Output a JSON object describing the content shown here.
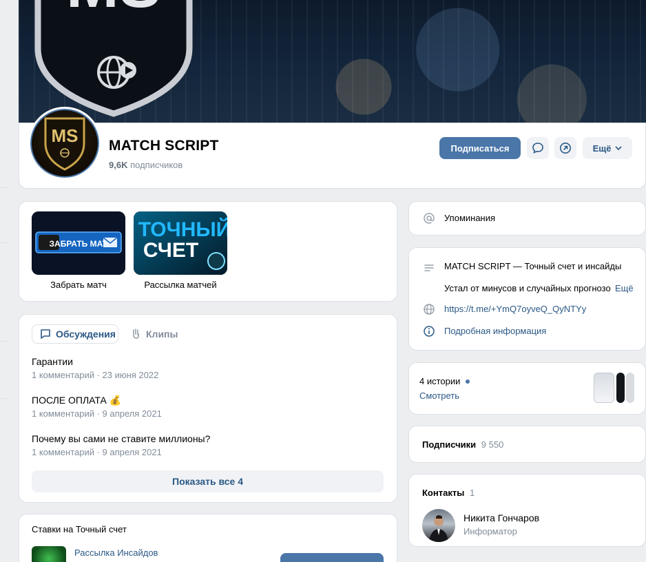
{
  "header": {
    "group_name": "MATCH SCRIPT",
    "subscribers_count": "9,6K",
    "subscribers_label": "подписчиков",
    "subscribe_button": "Подписаться",
    "more_button": "Ещё",
    "cover_logo_text": "MS"
  },
  "apps": [
    {
      "label": "Забрать матч",
      "tile_text": "ЗАБРАТЬ МАТЧ"
    },
    {
      "label": "Рассылка матчей",
      "tile_text_1": "ТОЧНЫЙ",
      "tile_text_2": "СЧЕТ"
    }
  ],
  "tabs": {
    "discussions": "Обсуждения",
    "clips": "Клипы"
  },
  "discussions": [
    {
      "title": "Гарантии",
      "comments": "1 комментарий",
      "date": "23 июня 2022"
    },
    {
      "title": "ПОСЛЕ ОПЛАТА 💰",
      "comments": "1 комментарий",
      "date": "9 апреля 2021"
    },
    {
      "title": "Почему вы сами не ставите миллионы?",
      "comments": "1 комментарий",
      "date": "9 апреля 2021"
    }
  ],
  "show_all": "Показать все 4",
  "bets_card": {
    "title": "Ставки на Точный счет",
    "item_label": "Рассылка Инсайдов"
  },
  "mentions": "Упоминания",
  "info": {
    "description_title": "MATCH SCRIPT — Точный счет и инсайды",
    "description_text": "Устал от минусов и случайных прогнозо",
    "more_link": "Ещё",
    "url": "https://t.me/+YmQ7oyveQ_QyNTYy",
    "details": "Подробная информация"
  },
  "stories": {
    "count_label": "4 истории",
    "view_link": "Смотреть"
  },
  "subscribers": {
    "label": "Подписчики",
    "count": "9 550"
  },
  "contacts": {
    "label": "Контакты",
    "count": "1",
    "name": "Никита Гончаров",
    "role": "Информатор"
  },
  "colors": {
    "accent": "#4a76a8",
    "link": "#2a5885",
    "background": "#edeef0",
    "gold": "#c9a44a"
  }
}
